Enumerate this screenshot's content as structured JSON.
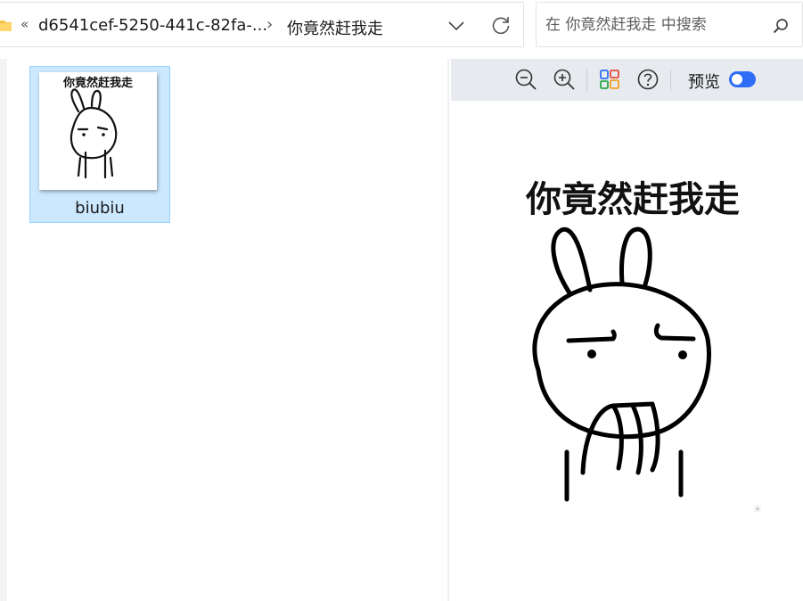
{
  "address_bar": {
    "overflow": "«",
    "folder_id": "d6541cef-5250-441c-82fa-...",
    "separator": "›",
    "current_folder": "你竟然赶我走"
  },
  "search": {
    "placeholder": "在 你竟然赶我走 中搜索"
  },
  "files": [
    {
      "name": "biubiu",
      "selected": true,
      "thumbnail_caption": "你竟然赶我走"
    }
  ],
  "preview_toolbar": {
    "zoom_out_icon": "zoom-out-icon",
    "zoom_in_icon": "zoom-in-icon",
    "apps_icon": "apps-icon",
    "help_icon": "help-icon",
    "preview_label": "预览",
    "preview_toggle_on": true
  },
  "preview": {
    "caption": "你竟然赶我走",
    "watermark": "☀"
  },
  "colors": {
    "selection_bg": "#cce8ff",
    "selection_border": "#99d1ff",
    "toolbar_bg": "#e7eaee",
    "toggle_on": "#2f6df6",
    "folder_yellow": "#f5c342"
  }
}
